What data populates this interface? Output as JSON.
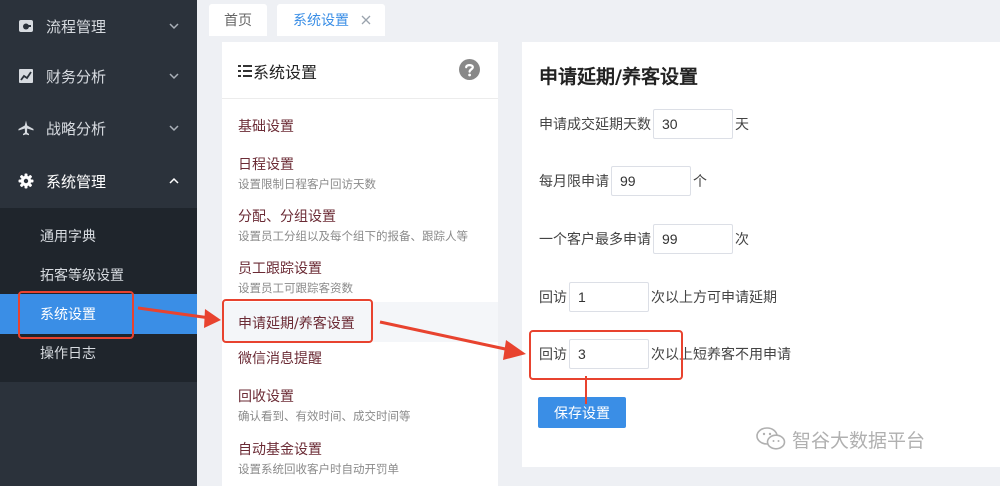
{
  "sidebar": {
    "groups": [
      {
        "label": "流程管理",
        "icon": "process-icon"
      },
      {
        "label": "财务分析",
        "icon": "chart-icon"
      },
      {
        "label": "战略分析",
        "icon": "plane-icon"
      },
      {
        "label": "系统管理",
        "icon": "gear-icon"
      }
    ],
    "sub_items": [
      {
        "label": "通用字典"
      },
      {
        "label": "拓客等级设置"
      },
      {
        "label": "系统设置"
      },
      {
        "label": "操作日志"
      }
    ]
  },
  "tabs": [
    {
      "label": "首页"
    },
    {
      "label": "系统设置"
    }
  ],
  "menu": {
    "title": "系统设置",
    "items": [
      {
        "name": "基础设置",
        "desc": ""
      },
      {
        "name": "日程设置",
        "desc": "设置限制日程客户回访天数"
      },
      {
        "name": "分配、分组设置",
        "desc": "设置员工分组以及每个组下的报备、跟踪人等"
      },
      {
        "name": "员工跟踪设置",
        "desc": "设置员工可跟踪客资数"
      },
      {
        "name": "申请延期/养客设置",
        "desc": ""
      },
      {
        "name": "微信消息提醒",
        "desc": ""
      },
      {
        "name": "回收设置",
        "desc": "确认看到、有效时间、成交时间等"
      },
      {
        "name": "自动基金设置",
        "desc": "设置系统回收客户时自动开罚单"
      }
    ]
  },
  "form": {
    "title": "申请延期/养客设置",
    "rows": [
      {
        "prefix": "申请成交延期天数",
        "value": "30",
        "suffix": "天"
      },
      {
        "prefix": "每月限申请",
        "value": "99",
        "suffix": "个"
      },
      {
        "prefix": "一个客户最多申请",
        "value": "99",
        "suffix": "次"
      },
      {
        "prefix": "回访",
        "value": "1",
        "suffix": "次以上方可申请延期"
      },
      {
        "prefix": "回访",
        "value": "3",
        "suffix": "次以上短养客不用申请"
      }
    ],
    "save_label": "保存设置"
  },
  "watermark": {
    "text": "智谷大数据平台"
  },
  "colors": {
    "accent": "#3a8ee6",
    "sidebar": "#2b323b",
    "annotation": "#e8432f"
  }
}
